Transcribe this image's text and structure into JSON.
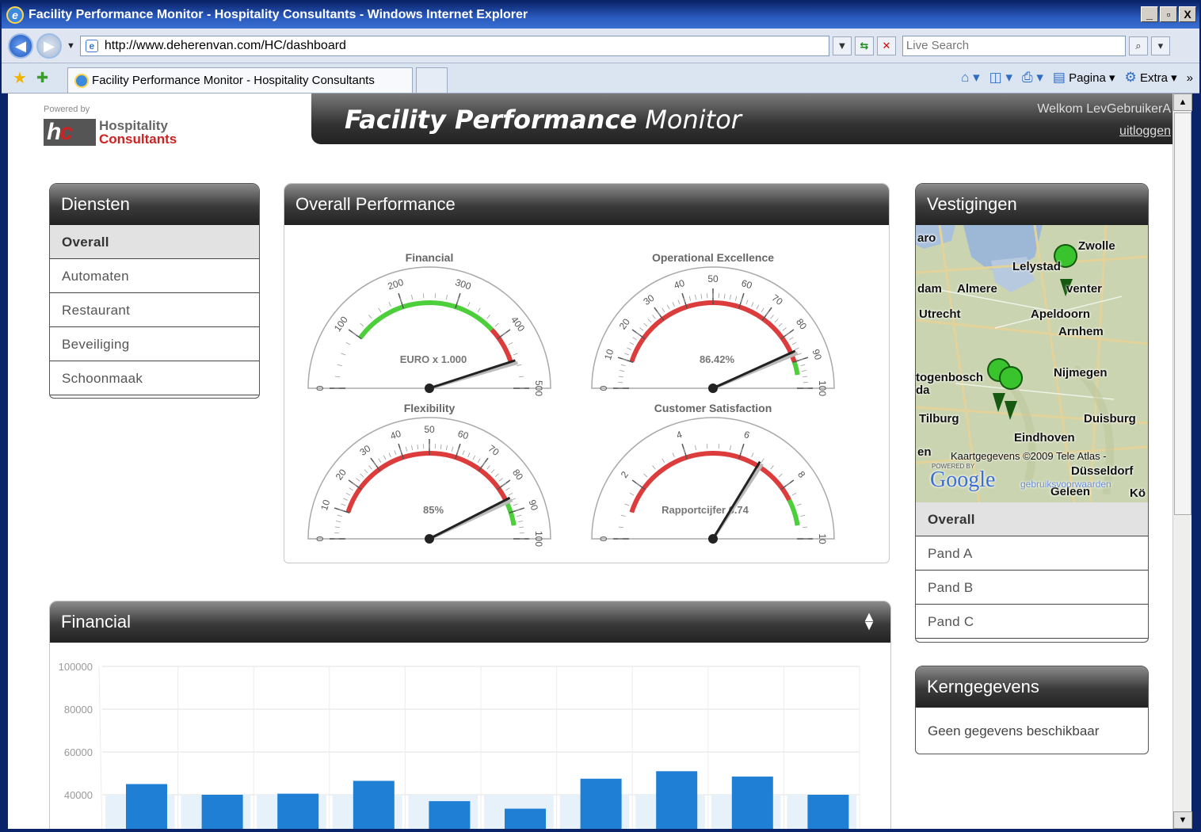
{
  "window": {
    "title": "Facility Performance Monitor - Hospitality Consultants - Windows Internet Explorer",
    "min": "_",
    "max": "▫",
    "close": "X"
  },
  "address": {
    "url": "http://www.deherenvan.com/HC/dashboard",
    "search_placeholder": "Live Search"
  },
  "tab": {
    "label": "Facility Performance Monitor - Hospitality Consultants"
  },
  "commandbar": {
    "pagina": "Pagina",
    "extra": "Extra"
  },
  "logo": {
    "powered_by": "Powered by",
    "line1": "Hospitality",
    "line2": "Consultants",
    "mark": "hc"
  },
  "header": {
    "title_bold": "Facility Performance",
    "title_light": "Monitor",
    "welcome": "Welkom LevGebruikerA",
    "logout": "uitloggen"
  },
  "diensten": {
    "title": "Diensten",
    "items": [
      "Overall",
      "Automaten",
      "Restaurant",
      "Beveiliging",
      "Schoonmaak"
    ],
    "selected": 0
  },
  "overall": {
    "title": "Overall Performance",
    "gauges": [
      {
        "title": "Financial",
        "min": 0,
        "max": 500,
        "ticks": [
          "0",
          "100",
          "200",
          "300",
          "400",
          "500"
        ],
        "value": 450,
        "label": "EURO x 1.000",
        "green": [
          100,
          380
        ],
        "red": [
          380,
          450
        ]
      },
      {
        "title": "Operational Excellence",
        "min": 0,
        "max": 100,
        "ticks": [
          "0",
          "10",
          "20",
          "30",
          "40",
          "50",
          "60",
          "70",
          "80",
          "90",
          "100"
        ],
        "value": 86.42,
        "label": "86.42%",
        "green": [
          90,
          95
        ],
        "red": [
          10,
          90
        ]
      },
      {
        "title": "Flexibility",
        "min": 0,
        "max": 100,
        "ticks": [
          "0",
          "10",
          "20",
          "30",
          "40",
          "50",
          "60",
          "70",
          "80",
          "90",
          "100"
        ],
        "value": 85,
        "label": "85%",
        "green": [
          85,
          95
        ],
        "red": [
          10,
          85
        ]
      },
      {
        "title": "Customer Satisfaction",
        "min": 0,
        "max": 10,
        "ticks": [
          "0",
          "2",
          "4",
          "6",
          "8",
          "10"
        ],
        "value": 6.74,
        "label": "Rapportcijfer 6.74",
        "green": [
          8.5,
          9.5
        ],
        "red": [
          1,
          8.5
        ]
      }
    ]
  },
  "vestigingen": {
    "title": "Vestigingen",
    "items": [
      "Overall",
      "Pand A",
      "Pand B",
      "Pand C"
    ],
    "selected": 0,
    "map": {
      "places": [
        "aro",
        "Zwolle",
        "Lelystad",
        "dam",
        "Almere",
        "venter",
        "Utrecht",
        "Apeldoorn",
        "Arnhem",
        "togenbosch",
        "da",
        "Nijmegen",
        "Tilburg",
        "Duisburg",
        "Eindhoven",
        "en",
        "Düsseldorf",
        "Geleen",
        "Kö"
      ],
      "attribution": "Kaartgegevens ©2009 Tele Atlas -",
      "powered": "POWERED BY",
      "google": "Google",
      "terms": "gebruiksvoorwaarden"
    }
  },
  "kerngegevens": {
    "title": "Kerngegevens",
    "message": "Geen gegevens beschikbaar"
  },
  "financial": {
    "title": "Financial"
  },
  "chart_data": {
    "type": "bar",
    "title": "",
    "yticks": [
      "100000",
      "80000",
      "60000",
      "40000"
    ],
    "ylim": [
      20000,
      100000
    ],
    "values": [
      45000,
      40000,
      40500,
      46500,
      37000,
      33500,
      47500,
      51000,
      48500,
      40000
    ],
    "background_values": [
      40000,
      40000,
      40000,
      40000,
      40000,
      40000,
      40000,
      40000,
      40000,
      40000
    ],
    "colors": {
      "bar": "#1f7fd4",
      "background": "#e6f1fa"
    }
  }
}
